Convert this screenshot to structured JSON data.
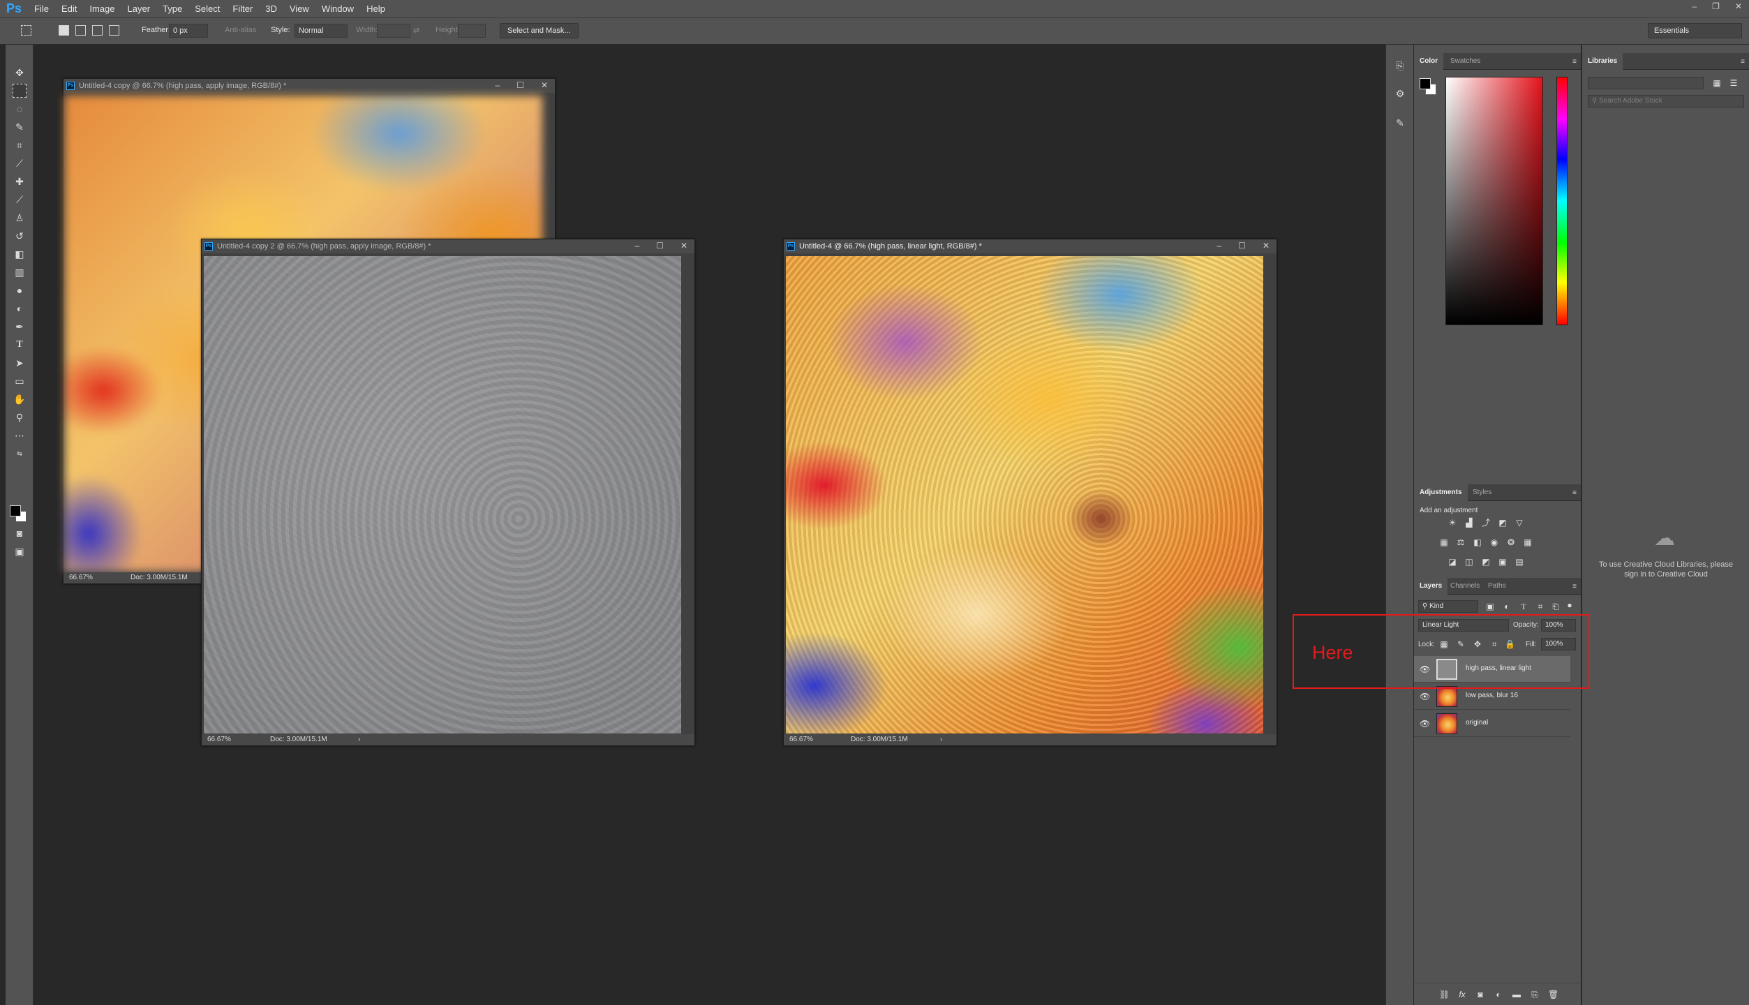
{
  "app": {
    "logo": "Ps"
  },
  "menu": [
    "File",
    "Edit",
    "Image",
    "Layer",
    "Type",
    "Select",
    "Filter",
    "3D",
    "View",
    "Window",
    "Help"
  ],
  "window_controls": [
    "–",
    "❐",
    "✕"
  ],
  "options_bar": {
    "feather_label": "Feather:",
    "feather_value": "0 px",
    "anti_alias_label": "Anti-alias",
    "style_label": "Style:",
    "style_value": "Normal",
    "width_label": "Width:",
    "height_label": "Height:",
    "select_mask_button": "Select and Mask...",
    "workspace": "Essentials"
  },
  "documents": [
    {
      "title": "Untitled-4 copy @ 66.7% (high pass, apply image, RGB/8#) *",
      "zoom": "66.67%",
      "doc_info": "Doc: 3.00M/15.1M"
    },
    {
      "title": "Untitled-4 copy 2 @ 66.7% (high pass, apply image, RGB/8#) *",
      "zoom": "66.67%",
      "doc_info": "Doc: 3.00M/15.1M"
    },
    {
      "title": "Untitled-4 @ 66.7% (high pass, linear light, RGB/8#) *",
      "zoom": "66.67%",
      "doc_info": "Doc: 3.00M/15.1M"
    }
  ],
  "doc_window_buttons": [
    "–",
    "☐",
    "✕"
  ],
  "color_panel": {
    "tabs": [
      "Color",
      "Swatches"
    ]
  },
  "adjustments_panel": {
    "tabs": [
      "Adjustments",
      "Styles"
    ],
    "heading": "Add an adjustment"
  },
  "layers_panel": {
    "tabs": [
      "Layers",
      "Channels",
      "Paths"
    ],
    "filter_kind": "Kind",
    "blend_mode": "Linear Light",
    "opacity_label": "Opacity:",
    "opacity_value": "100%",
    "lock_label": "Lock:",
    "fill_label": "Fill:",
    "fill_value": "100%",
    "layers": [
      {
        "name": "high pass, linear light",
        "selected": true
      },
      {
        "name": "low pass, blur 16",
        "selected": false
      },
      {
        "name": "original",
        "selected": false
      }
    ]
  },
  "libraries_panel": {
    "tab": "Libraries",
    "search_placeholder": "Search Adobe Stock",
    "message": "To use Creative Cloud Libraries, please sign in to Creative Cloud"
  },
  "annotation": {
    "text": "Here",
    "color": "#e21b1b"
  },
  "colors": {
    "accent": "#31a8ff",
    "panel": "#535353",
    "workspace_bg": "#282828"
  }
}
